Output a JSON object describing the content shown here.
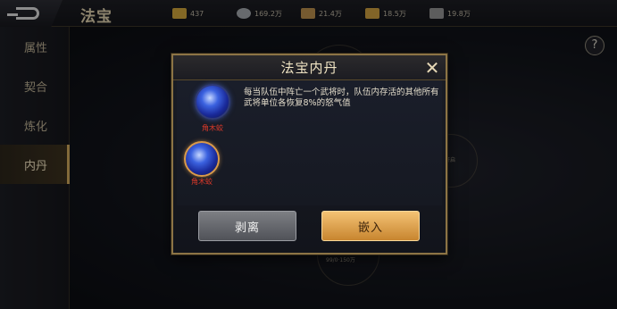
{
  "header": {
    "title": "法宝",
    "resources": [
      {
        "icon": "gold-ingot-icon",
        "value": "437",
        "color": "#c9a03a"
      },
      {
        "icon": "silver-coin-icon",
        "value": "169.2万",
        "color": "#9fa4a8"
      },
      {
        "icon": "wine-jar-icon",
        "value": "21.4万",
        "color": "#b48a4a"
      },
      {
        "icon": "coin-pouch-icon",
        "value": "18.5万",
        "color": "#c79a3e"
      },
      {
        "icon": "iron-ore-icon",
        "value": "19.8万",
        "color": "#8f8f8f"
      }
    ]
  },
  "sidebar": {
    "items": [
      {
        "label": "属性",
        "active": false
      },
      {
        "label": "契合",
        "active": false
      },
      {
        "label": "炼化",
        "active": false
      },
      {
        "label": "内丹",
        "active": true
      }
    ]
  },
  "help": {
    "label": "?"
  },
  "background_text": {
    "slot_open": "开启",
    "slot_bottom": "99/0·150万"
  },
  "dialog": {
    "title": "法宝内丹",
    "close_label": "✕",
    "description": "每当队伍中阵亡一个武将时，队伍内存活的其他所有武将单位各恢复8%的怒气值",
    "pills": [
      {
        "name": "角木蛟",
        "selected": false
      },
      {
        "name": "角木蛟",
        "selected": true
      }
    ],
    "buttons": {
      "strip": "剥离",
      "embed": "嵌入"
    }
  }
}
